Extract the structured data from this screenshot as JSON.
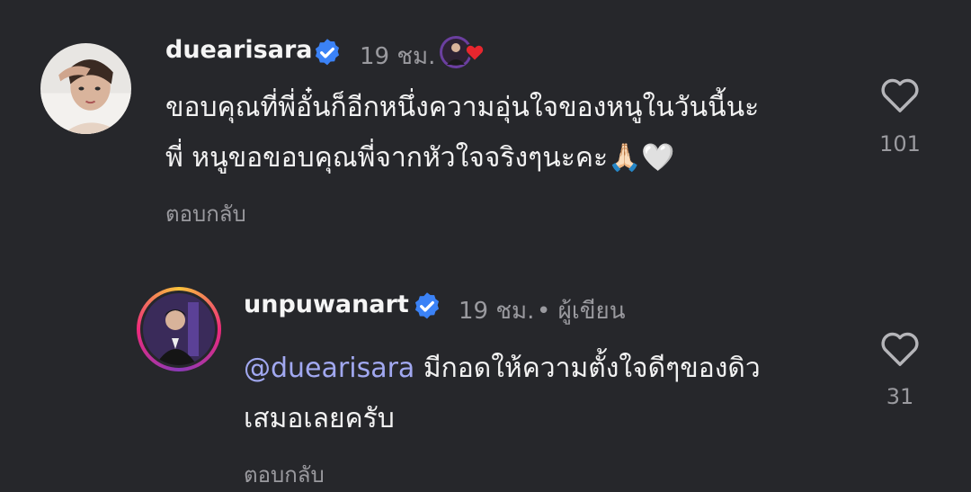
{
  "comments": [
    {
      "username": "duearisara",
      "time": "19 ชม.",
      "text": "ขอบคุณที่พี่อั๋นก็อีกหนึ่งความอุ่นใจของหนูในวันนี้นะ\nพี่ หนูขอขอบคุณพี่จากหัวใจจริงๆนะคะ🙏🏻🤍",
      "reply_label": "ตอบกลับ",
      "likes": "101"
    },
    {
      "username": "unpuwanart",
      "time": "19 ชม.",
      "author_label": "• ผู้เขียน",
      "mention": "@duearisara",
      "text": " มีกอดให้ความตั้งใจดีๆของดิว\nเสมอเลยครับ",
      "reply_label": "ตอบกลับ",
      "likes": "31"
    }
  ],
  "colors": {
    "background": "#26272b",
    "verified": "#3b82f6",
    "mention": "#a1a8f0",
    "muted": "#9a9a9f"
  },
  "icons": [
    "verified-badge-icon",
    "heart-outline-icon",
    "creator-liked-heart-icon"
  ]
}
